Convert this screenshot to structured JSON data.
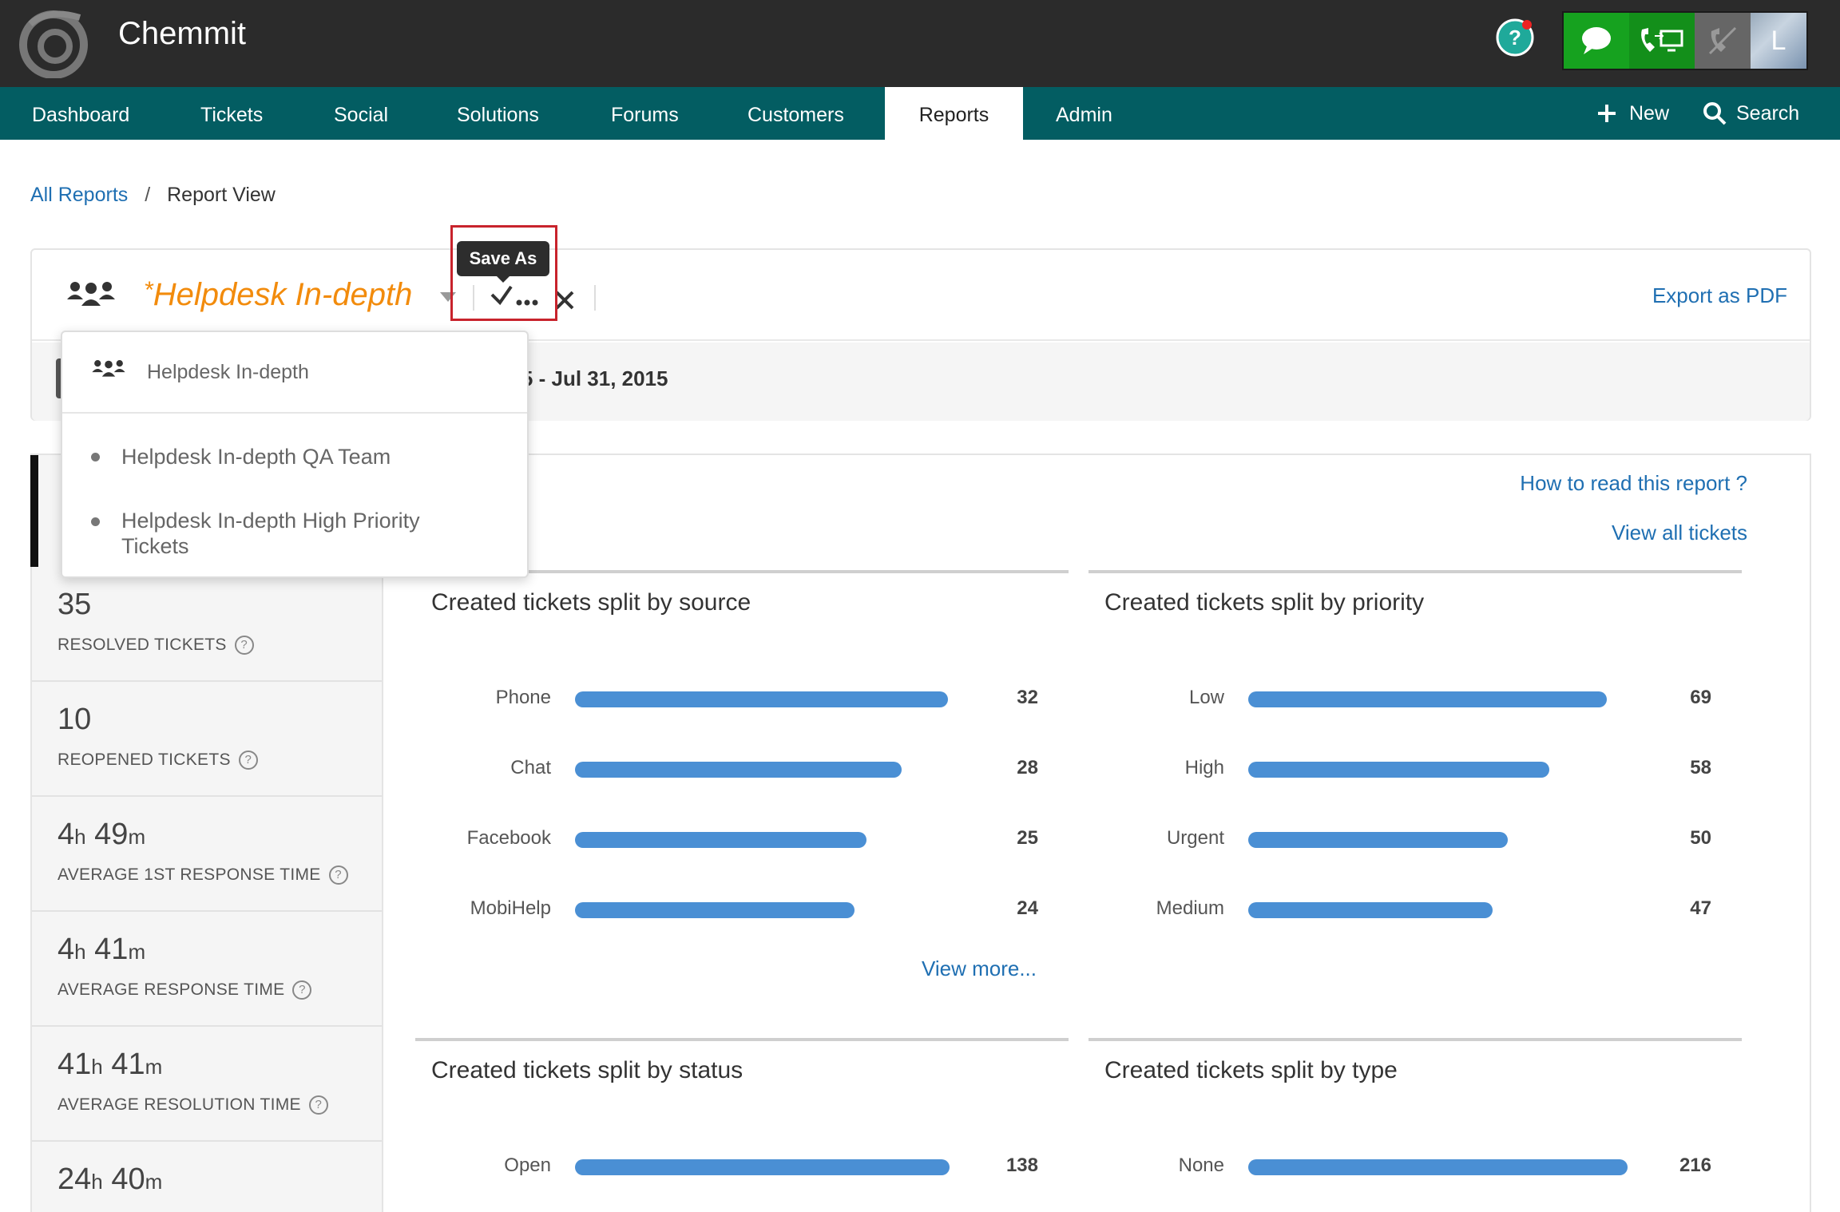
{
  "header": {
    "app_title": "Chemmit",
    "avatar_initial": "L",
    "colors": {
      "header_bg": "#2b2b2b",
      "nav_bg": "#035d62",
      "accent_green": "#16a21f"
    }
  },
  "nav": {
    "items": [
      {
        "label": "Dashboard"
      },
      {
        "label": "Tickets"
      },
      {
        "label": "Social"
      },
      {
        "label": "Solutions"
      },
      {
        "label": "Forums"
      },
      {
        "label": "Customers"
      },
      {
        "label": "Reports",
        "active": true
      },
      {
        "label": "Admin"
      }
    ],
    "new_label": "New",
    "search_label": "Search"
  },
  "breadcrumb": {
    "root": "All Reports",
    "separator": "/",
    "current": "Report View"
  },
  "report": {
    "modified_marker": "*",
    "title": "Helpdesk In-depth",
    "tooltip": "Save As",
    "export_label": "Export as PDF",
    "date_range": "015 - Jul 31, 2015"
  },
  "dropdown": {
    "header_label": "Helpdesk In-depth",
    "items": [
      {
        "label": "Helpdesk In-depth QA Team"
      },
      {
        "label": "Helpdesk In-depth High Priority Tickets"
      }
    ]
  },
  "metrics": [
    {
      "value": "35",
      "label": "RESOLVED TICKETS"
    },
    {
      "value": "10",
      "label": "REOPENED TICKETS"
    },
    {
      "h": "4",
      "m": "49",
      "label": "AVERAGE 1ST RESPONSE TIME"
    },
    {
      "h": "4",
      "m": "41",
      "label": "AVERAGE RESPONSE TIME"
    },
    {
      "h": "41",
      "m": "41",
      "label": "AVERAGE RESOLUTION TIME"
    },
    {
      "h": "24",
      "m": "40",
      "label": ""
    }
  ],
  "units": {
    "h": "h",
    "m": "m"
  },
  "links": {
    "how_to_read": "How to read this report ?",
    "view_all": "View all tickets",
    "view_more": "View more..."
  },
  "chart_data": [
    {
      "type": "bar",
      "title": "Created tickets split by source",
      "categories": [
        "Phone",
        "Chat",
        "Facebook",
        "MobiHelp"
      ],
      "values": [
        32,
        28,
        25,
        24
      ],
      "orientation": "horizontal"
    },
    {
      "type": "bar",
      "title": "Created tickets split by priority",
      "categories": [
        "Low",
        "High",
        "Urgent",
        "Medium"
      ],
      "values": [
        69,
        58,
        50,
        47
      ],
      "orientation": "horizontal"
    },
    {
      "type": "bar",
      "title": "Created tickets split by status",
      "categories": [
        "Open"
      ],
      "values": [
        138
      ],
      "orientation": "horizontal"
    },
    {
      "type": "bar",
      "title": "Created tickets split by type",
      "categories": [
        "None"
      ],
      "values": [
        216
      ],
      "orientation": "horizontal"
    }
  ]
}
